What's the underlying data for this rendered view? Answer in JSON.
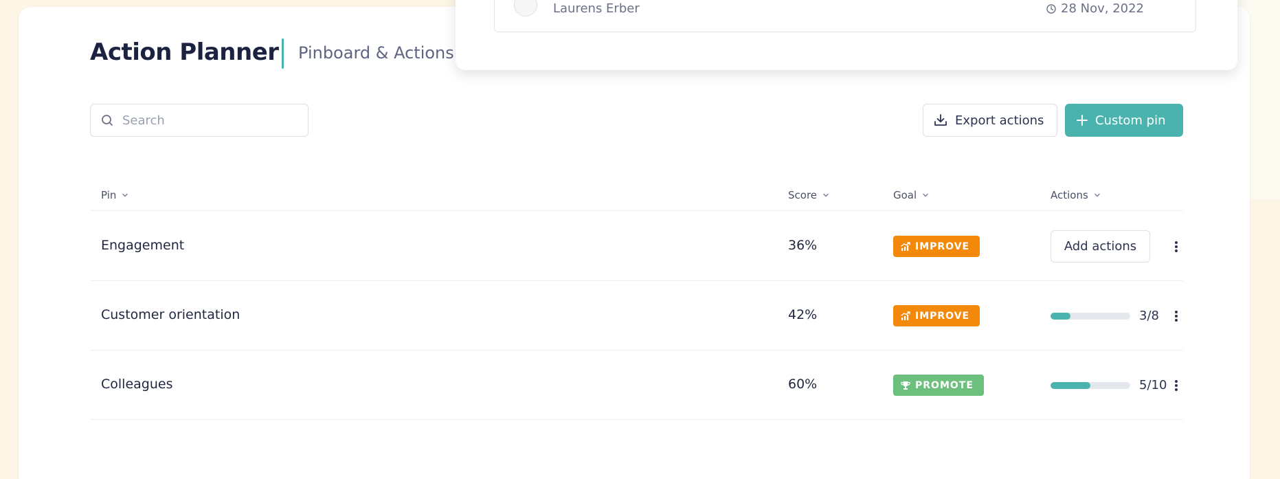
{
  "header": {
    "title": "Action Planner",
    "subtitle": "Pinboard & Actions"
  },
  "search": {
    "placeholder": "Search",
    "value": ""
  },
  "toolbar": {
    "export_label": "Export actions",
    "custom_pin_label": "Custom pin"
  },
  "table": {
    "columns": {
      "pin": "Pin",
      "score": "Score",
      "goal": "Goal",
      "actions": "Actions"
    },
    "rows": [
      {
        "pin": "Engagement",
        "score": "36%",
        "goal": "IMPROVE",
        "actions_label": "Add actions"
      },
      {
        "pin": "Customer orientation",
        "score": "42%",
        "goal": "IMPROVE",
        "progress_text": "3/8",
        "progress": 0.25
      },
      {
        "pin": "Colleagues",
        "score": "60%",
        "goal": "PROMOTE",
        "progress_text": "5/10",
        "progress": 0.5
      }
    ]
  },
  "popover": {
    "author": "Laurens Erber",
    "date": "28 Nov, 2022"
  },
  "colors": {
    "accent": "#4bb3ae",
    "improve": "#f2890a",
    "promote": "#6cbf7c"
  }
}
